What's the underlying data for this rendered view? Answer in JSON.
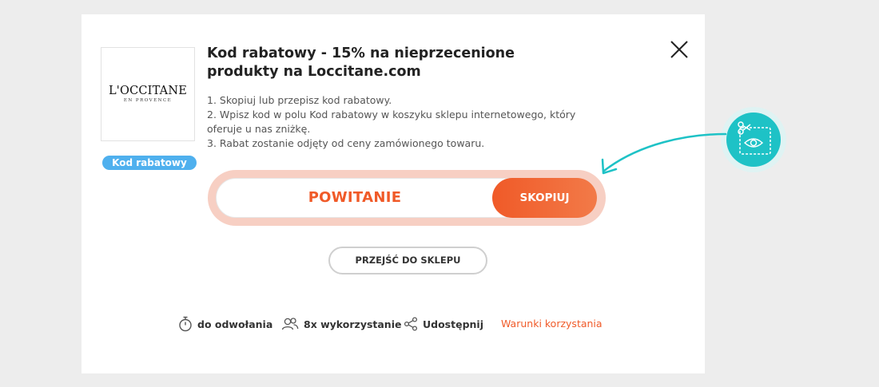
{
  "brand": {
    "logo_main": "L'OCCITANE",
    "logo_sub": "EN PROVENCE",
    "badge": "Kod rabatowy"
  },
  "offer": {
    "title": "Kod rabatowy - 15% na nieprzecenione produkty na Loccitane.com",
    "steps": [
      "1. Skopiuj lub przepisz kod rabatowy.",
      "2. Wpisz kod w polu Kod rabatowy w koszyku sklepu internetowego, który oferuje u nas zniżkę.",
      "3. Rabat zostanie odjęty od ceny zamówionego towaru."
    ]
  },
  "coupon": {
    "code": "POWITANIE",
    "copy_label": "SKOPIUJ"
  },
  "actions": {
    "shop_label": "PRZEJŚĆ DO SKLEPU"
  },
  "footer": {
    "validity": "do odwołania",
    "usage": "8x wykorzystanie",
    "share": "Udostępnij",
    "terms": "Warunki korzystania"
  },
  "colors": {
    "accent": "#f05a28",
    "badge": "#4fb0ee",
    "hint": "#1ec2c6",
    "code_halo": "#f7cfc3"
  },
  "icons": {
    "close": "close-icon",
    "timer": "stopwatch-icon",
    "users": "users-icon",
    "share": "share-icon",
    "hint": "scissors-coupon-icon"
  }
}
